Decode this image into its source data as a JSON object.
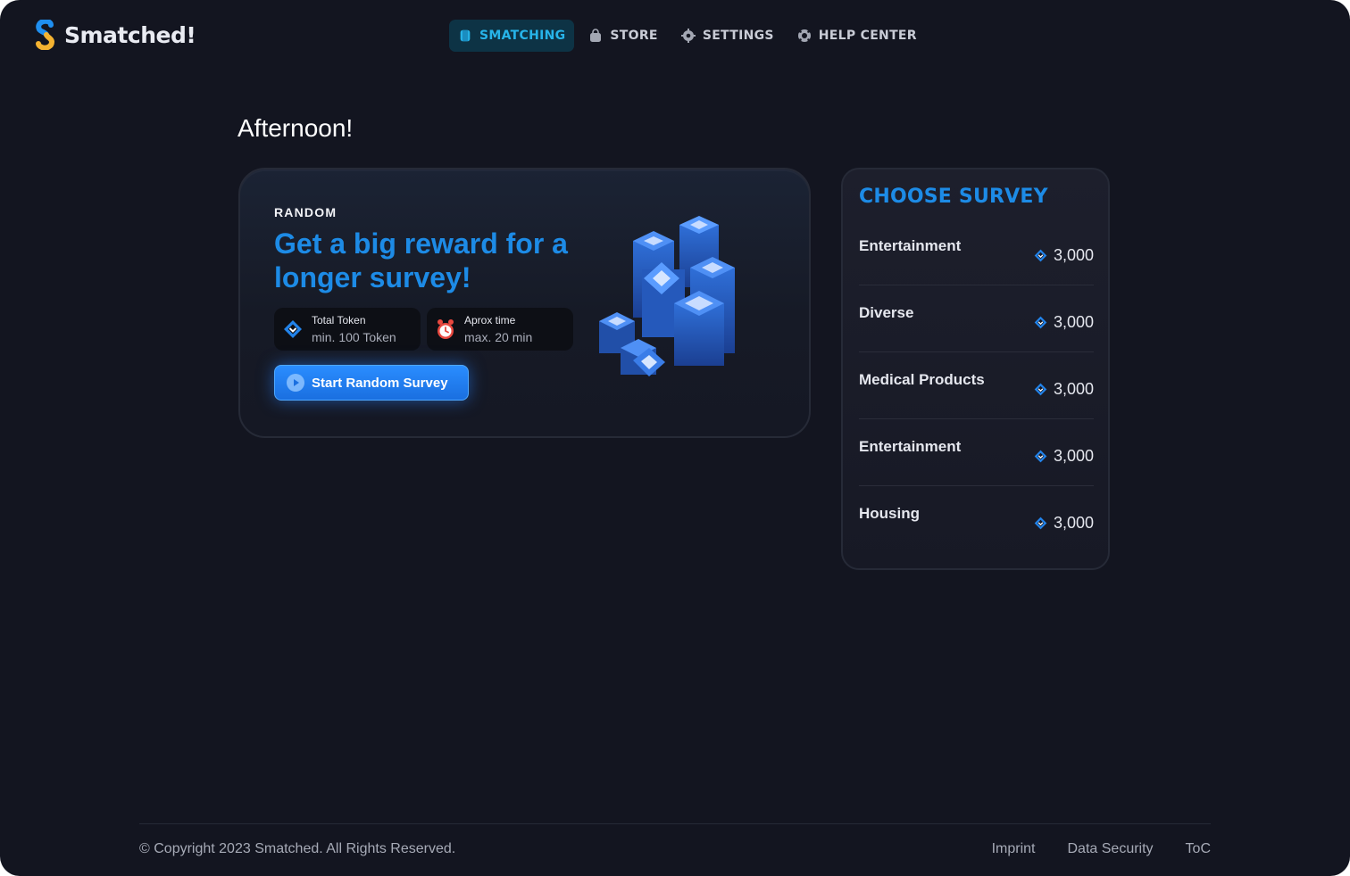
{
  "brand": {
    "name": "Smatched!",
    "logo_icon": "smatched-s-logo"
  },
  "nav": {
    "items": [
      {
        "label": "SMATCHING",
        "icon": "card-icon",
        "active": true
      },
      {
        "label": "STORE",
        "icon": "bag-icon",
        "active": false
      },
      {
        "label": "SETTINGS",
        "icon": "gear-icon",
        "active": false
      },
      {
        "label": "HELP CENTER",
        "icon": "lifebuoy-icon",
        "active": false
      }
    ]
  },
  "greeting": "Afternoon!",
  "random_card": {
    "kicker": "RANDOM",
    "title": "Get a big reward for a longer survey!",
    "token_pill": {
      "label": "Total Token",
      "value": "min. 100 Token"
    },
    "time_pill": {
      "label": "Aprox time",
      "value": "max. 20 min"
    },
    "start_button": "Start Random Survey"
  },
  "survey_panel": {
    "title": "CHOOSE SURVEY",
    "items": [
      {
        "name": "Entertainment",
        "reward": "3,000"
      },
      {
        "name": "Diverse",
        "reward": "3,000"
      },
      {
        "name": "Medical Products",
        "reward": "3,000"
      },
      {
        "name": "Entertainment",
        "reward": "3,000"
      },
      {
        "name": "Housing",
        "reward": "3,000"
      }
    ]
  },
  "footer": {
    "copyright": "© Copyright 2023 Smatched. All Rights Reserved.",
    "links": [
      "Imprint",
      "Data Security",
      "ToC"
    ]
  },
  "colors": {
    "background": "#131520",
    "accent": "#1d8be6",
    "nav_active": "#27b4e9",
    "button": "#2a8dff"
  }
}
